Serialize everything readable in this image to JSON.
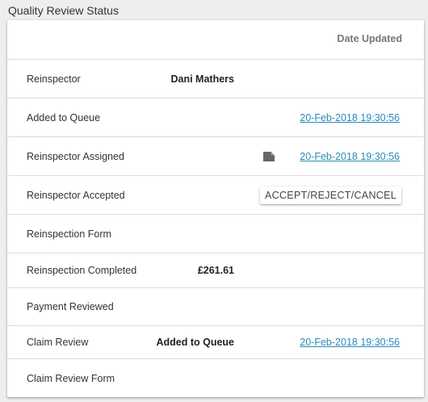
{
  "section": {
    "title": "Quality Review Status"
  },
  "table": {
    "header": {
      "date_updated": "Date Updated"
    },
    "rows": [
      {
        "label": "Reinspector",
        "value": "Dani Mathers",
        "date": ""
      },
      {
        "label": "Added to Queue",
        "value": "",
        "date": "20-Feb-2018 19:30:56"
      },
      {
        "label": "Reinspector Assigned",
        "value": "",
        "date": "20-Feb-2018 19:30:56",
        "icon": "document-icon"
      },
      {
        "label": "Reinspector Accepted",
        "value": "",
        "date": "",
        "action": "ACCEPT/REJECT/CANCEL"
      },
      {
        "label": "Reinspection Form",
        "value": "",
        "date": ""
      },
      {
        "label": "Reinspection Completed",
        "value": "£261.61",
        "date": ""
      },
      {
        "label": "Payment Reviewed",
        "value": "",
        "date": ""
      },
      {
        "label": "Claim Review",
        "value": "Added to Queue",
        "date": "20-Feb-2018 19:30:56"
      },
      {
        "label": "Claim Review Form",
        "value": "",
        "date": ""
      }
    ]
  },
  "colors": {
    "link": "#2a8ab8",
    "background": "#eeeeee",
    "card": "#ffffff",
    "divider": "#dddddd"
  }
}
